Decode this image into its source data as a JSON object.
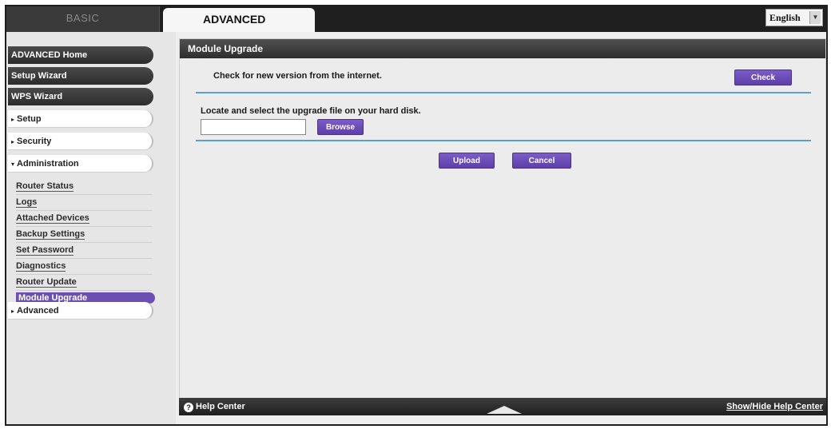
{
  "tabs": {
    "basic": "BASIC",
    "advanced": "ADVANCED"
  },
  "language": {
    "selected": "English"
  },
  "sidebar": {
    "items": [
      {
        "label": "ADVANCED Home"
      },
      {
        "label": "Setup Wizard"
      },
      {
        "label": "WPS Wizard"
      }
    ],
    "sections": [
      {
        "label": "Setup",
        "expander": "▸"
      },
      {
        "label": "Security",
        "expander": "▸"
      },
      {
        "label": "Administration",
        "expander": "▾"
      }
    ],
    "admin_items": [
      {
        "label": "Router Status"
      },
      {
        "label": "Logs"
      },
      {
        "label": "Attached Devices"
      },
      {
        "label": "Backup Settings"
      },
      {
        "label": "Set Password"
      },
      {
        "label": "Diagnostics"
      },
      {
        "label": "Router Update"
      },
      {
        "label": "Module Upgrade"
      }
    ],
    "advanced_section": {
      "label": "Advanced",
      "expander": "▸"
    }
  },
  "main": {
    "title": "Module Upgrade",
    "check_text": "Check for new version from the internet.",
    "check_button": "Check",
    "locate_text": "Locate and select the upgrade file on your hard disk.",
    "file_value": "",
    "browse_button": "Browse",
    "upload_button": "Upload",
    "cancel_button": "Cancel"
  },
  "footer": {
    "help_center": "Help Center",
    "show_hide": "Show/Hide Help Center"
  },
  "colors": {
    "accent_purple": "#6b4fb3",
    "rule_blue": "#5a9fcf",
    "dark_bar": "#2e2e2e"
  }
}
